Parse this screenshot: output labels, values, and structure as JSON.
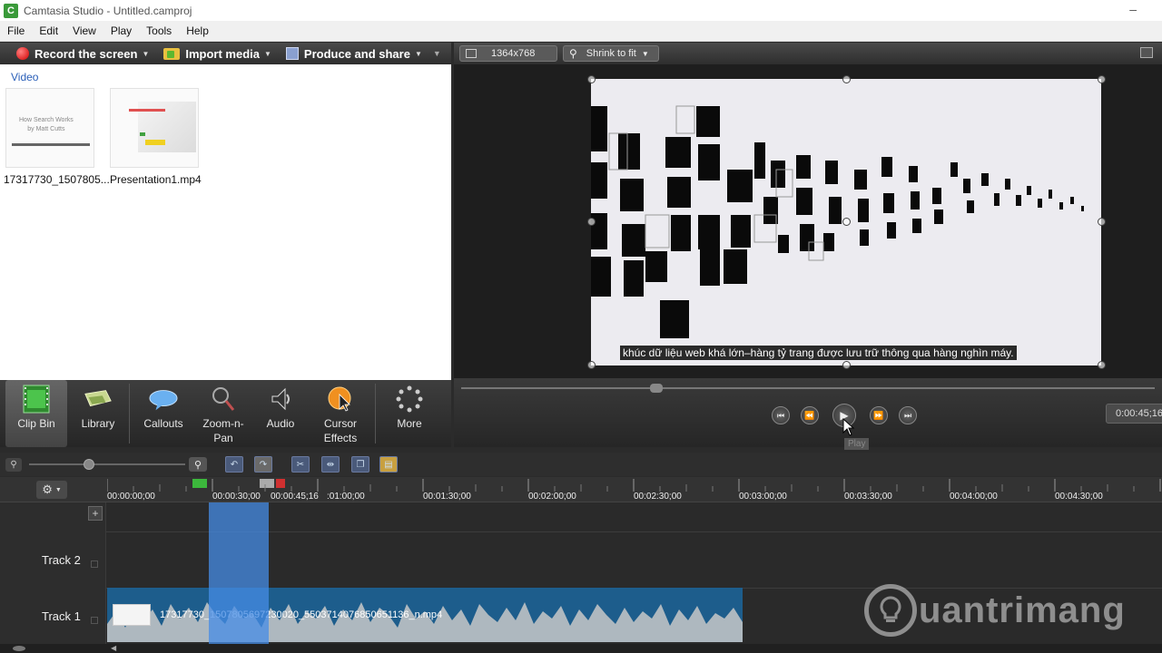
{
  "window": {
    "title": "Camtasia Studio - Untitled.camproj",
    "logo_letter": "C"
  },
  "menu": [
    "File",
    "Edit",
    "View",
    "Play",
    "Tools",
    "Help"
  ],
  "left_toolbar": {
    "record": "Record the screen",
    "import": "Import media",
    "produce": "Produce and share"
  },
  "clip_bin": {
    "section": "Video",
    "clips": [
      {
        "name": "17317730_1507805...",
        "thumb_text": "How Search Works\nby Matt Cutts"
      },
      {
        "name": "Presentation1.mp4"
      }
    ]
  },
  "tool_tabs": [
    {
      "label": "Clip Bin",
      "icon": "film-strip-icon",
      "active": true
    },
    {
      "label": "Library",
      "icon": "library-icon"
    },
    {
      "label": "Callouts",
      "icon": "speech-bubble-icon"
    },
    {
      "label": "Zoom-n-\nPan",
      "icon": "magnifier-icon"
    },
    {
      "label": "Audio",
      "icon": "speaker-icon"
    },
    {
      "label": "Cursor\nEffects",
      "icon": "cursor-effects-icon"
    },
    {
      "label": "More",
      "icon": "more-dots-icon"
    }
  ],
  "preview": {
    "resolution": "1364x768",
    "zoom": "Shrink to fit",
    "subtitle": "khúc dữ liệu web khá lớn–hàng tỷ trang được lưu trữ thông qua hàng nghìn máy."
  },
  "player": {
    "time": "0:00:45;16",
    "tooltip": "Play"
  },
  "timeline": {
    "ticks": [
      {
        "label": "00:00:00;00"
      },
      {
        "label": "00:00:30;00"
      },
      {
        "label": "00:00:45;16"
      },
      {
        "label": ":01:00;00"
      },
      {
        "label": "00:01:30;00"
      },
      {
        "label": "00:02:00;00"
      },
      {
        "label": "00:02:30;00"
      },
      {
        "label": "00:03:00;00"
      },
      {
        "label": "00:03:30;00"
      },
      {
        "label": "00:04:00;00"
      },
      {
        "label": "00:04:30;00"
      }
    ],
    "tracks": [
      "Track 2",
      "Track 1"
    ],
    "clip_label": "17317730_1507805697230020_5503714076850651136_n.mp4"
  },
  "watermark": "uantrimang",
  "colors": {
    "accent": "#2a5fb8",
    "selection": "#468ce6",
    "record": "#d00000",
    "clip": "#1d5d8c"
  }
}
